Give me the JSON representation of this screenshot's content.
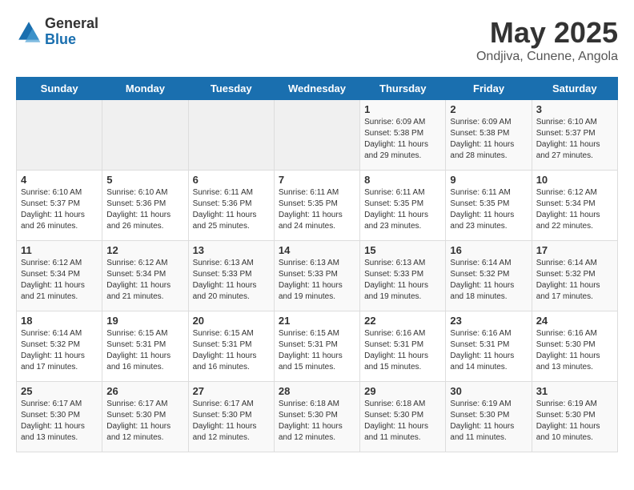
{
  "logo": {
    "general": "General",
    "blue": "Blue"
  },
  "title": "May 2025",
  "subtitle": "Ondjiva, Cunene, Angola",
  "days": [
    "Sunday",
    "Monday",
    "Tuesday",
    "Wednesday",
    "Thursday",
    "Friday",
    "Saturday"
  ],
  "weeks": [
    [
      {
        "day": "",
        "content": ""
      },
      {
        "day": "",
        "content": ""
      },
      {
        "day": "",
        "content": ""
      },
      {
        "day": "",
        "content": ""
      },
      {
        "day": "1",
        "content": "Sunrise: 6:09 AM\nSunset: 5:38 PM\nDaylight: 11 hours and 29 minutes."
      },
      {
        "day": "2",
        "content": "Sunrise: 6:09 AM\nSunset: 5:38 PM\nDaylight: 11 hours and 28 minutes."
      },
      {
        "day": "3",
        "content": "Sunrise: 6:10 AM\nSunset: 5:37 PM\nDaylight: 11 hours and 27 minutes."
      }
    ],
    [
      {
        "day": "4",
        "content": "Sunrise: 6:10 AM\nSunset: 5:37 PM\nDaylight: 11 hours and 26 minutes."
      },
      {
        "day": "5",
        "content": "Sunrise: 6:10 AM\nSunset: 5:36 PM\nDaylight: 11 hours and 26 minutes."
      },
      {
        "day": "6",
        "content": "Sunrise: 6:11 AM\nSunset: 5:36 PM\nDaylight: 11 hours and 25 minutes."
      },
      {
        "day": "7",
        "content": "Sunrise: 6:11 AM\nSunset: 5:35 PM\nDaylight: 11 hours and 24 minutes."
      },
      {
        "day": "8",
        "content": "Sunrise: 6:11 AM\nSunset: 5:35 PM\nDaylight: 11 hours and 23 minutes."
      },
      {
        "day": "9",
        "content": "Sunrise: 6:11 AM\nSunset: 5:35 PM\nDaylight: 11 hours and 23 minutes."
      },
      {
        "day": "10",
        "content": "Sunrise: 6:12 AM\nSunset: 5:34 PM\nDaylight: 11 hours and 22 minutes."
      }
    ],
    [
      {
        "day": "11",
        "content": "Sunrise: 6:12 AM\nSunset: 5:34 PM\nDaylight: 11 hours and 21 minutes."
      },
      {
        "day": "12",
        "content": "Sunrise: 6:12 AM\nSunset: 5:34 PM\nDaylight: 11 hours and 21 minutes."
      },
      {
        "day": "13",
        "content": "Sunrise: 6:13 AM\nSunset: 5:33 PM\nDaylight: 11 hours and 20 minutes."
      },
      {
        "day": "14",
        "content": "Sunrise: 6:13 AM\nSunset: 5:33 PM\nDaylight: 11 hours and 19 minutes."
      },
      {
        "day": "15",
        "content": "Sunrise: 6:13 AM\nSunset: 5:33 PM\nDaylight: 11 hours and 19 minutes."
      },
      {
        "day": "16",
        "content": "Sunrise: 6:14 AM\nSunset: 5:32 PM\nDaylight: 11 hours and 18 minutes."
      },
      {
        "day": "17",
        "content": "Sunrise: 6:14 AM\nSunset: 5:32 PM\nDaylight: 11 hours and 17 minutes."
      }
    ],
    [
      {
        "day": "18",
        "content": "Sunrise: 6:14 AM\nSunset: 5:32 PM\nDaylight: 11 hours and 17 minutes."
      },
      {
        "day": "19",
        "content": "Sunrise: 6:15 AM\nSunset: 5:31 PM\nDaylight: 11 hours and 16 minutes."
      },
      {
        "day": "20",
        "content": "Sunrise: 6:15 AM\nSunset: 5:31 PM\nDaylight: 11 hours and 16 minutes."
      },
      {
        "day": "21",
        "content": "Sunrise: 6:15 AM\nSunset: 5:31 PM\nDaylight: 11 hours and 15 minutes."
      },
      {
        "day": "22",
        "content": "Sunrise: 6:16 AM\nSunset: 5:31 PM\nDaylight: 11 hours and 15 minutes."
      },
      {
        "day": "23",
        "content": "Sunrise: 6:16 AM\nSunset: 5:31 PM\nDaylight: 11 hours and 14 minutes."
      },
      {
        "day": "24",
        "content": "Sunrise: 6:16 AM\nSunset: 5:30 PM\nDaylight: 11 hours and 13 minutes."
      }
    ],
    [
      {
        "day": "25",
        "content": "Sunrise: 6:17 AM\nSunset: 5:30 PM\nDaylight: 11 hours and 13 minutes."
      },
      {
        "day": "26",
        "content": "Sunrise: 6:17 AM\nSunset: 5:30 PM\nDaylight: 11 hours and 12 minutes."
      },
      {
        "day": "27",
        "content": "Sunrise: 6:17 AM\nSunset: 5:30 PM\nDaylight: 11 hours and 12 minutes."
      },
      {
        "day": "28",
        "content": "Sunrise: 6:18 AM\nSunset: 5:30 PM\nDaylight: 11 hours and 12 minutes."
      },
      {
        "day": "29",
        "content": "Sunrise: 6:18 AM\nSunset: 5:30 PM\nDaylight: 11 hours and 11 minutes."
      },
      {
        "day": "30",
        "content": "Sunrise: 6:19 AM\nSunset: 5:30 PM\nDaylight: 11 hours and 11 minutes."
      },
      {
        "day": "31",
        "content": "Sunrise: 6:19 AM\nSunset: 5:30 PM\nDaylight: 11 hours and 10 minutes."
      }
    ]
  ]
}
